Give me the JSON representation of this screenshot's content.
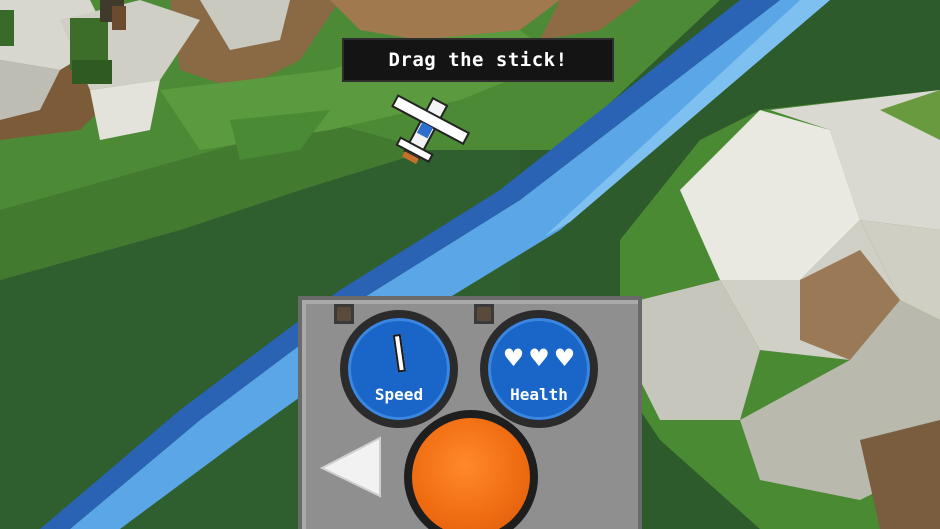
{
  "hud": {
    "hint": "Drag the stick!",
    "speed_label": "Speed",
    "health_label": "Health",
    "health_hearts": 3,
    "heart_glyph": "♥"
  },
  "colors": {
    "water": "#5aa6e6",
    "grass": "#3e7a30",
    "dial": "#1a66c8",
    "stick": "#f06d12",
    "panel": "#8f8f8f"
  },
  "icons": [
    "needle-icon",
    "heart-icon",
    "left-arrow-icon",
    "plane-icon"
  ]
}
